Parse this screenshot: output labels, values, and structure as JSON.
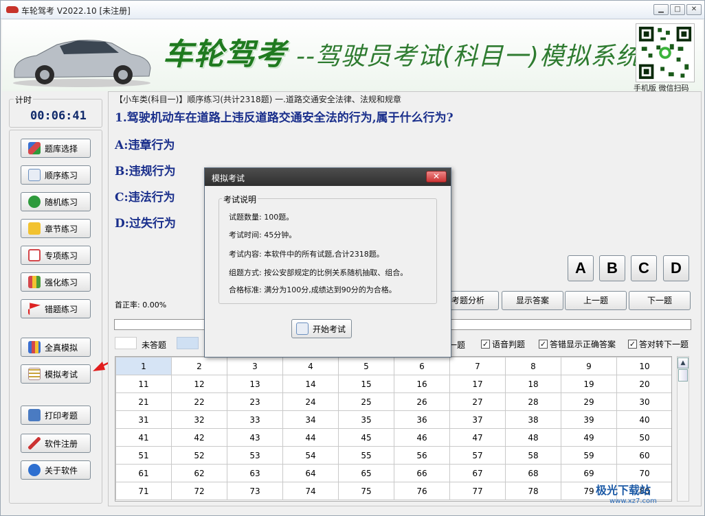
{
  "window": {
    "title": "车轮驾考 V2022.10 [未注册]",
    "min": "▁",
    "max": "□",
    "close": "✕"
  },
  "banner": {
    "brand": "车轮驾考",
    "subtitle": "--驾驶员考试(科目一)模拟系统",
    "qr_caption": "手机版 微信扫码"
  },
  "timer": {
    "label": "计时",
    "value": "00:06:41"
  },
  "sidebar": [
    {
      "label": "题库选择",
      "icon": "cubes-icon",
      "color": "#3a6fd1"
    },
    {
      "label": "顺序练习",
      "icon": "pencil-icon",
      "color": "#6a8fbf"
    },
    {
      "label": "随机练习",
      "icon": "refresh-icon",
      "color": "#2e9a3c"
    },
    {
      "label": "章节练习",
      "icon": "note-icon",
      "color": "#f2c230"
    },
    {
      "label": "专项练习",
      "icon": "checklist-icon",
      "color": "#d4474b"
    },
    {
      "label": "强化练习",
      "icon": "barchart-icon",
      "color": "#4b9c3a"
    },
    {
      "label": "错题练习",
      "icon": "flag-icon",
      "color": "#d22"
    },
    {
      "label": "全真模拟",
      "icon": "grid-icon",
      "color": "#3a6fd1"
    },
    {
      "label": "模拟考试",
      "icon": "table-icon",
      "color": "#c9a33a"
    },
    {
      "label": "打印考题",
      "icon": "printer-icon",
      "color": "#4a7bc2"
    },
    {
      "label": "软件注册",
      "icon": "pen-icon",
      "color": "#c33"
    },
    {
      "label": "关于软件",
      "icon": "info-icon",
      "color": "#2d6fd0"
    }
  ],
  "main": {
    "crumb": "【小车类(科目一)】顺序练习(共计2318题) 一.道路交通安全法律、法规和规章",
    "question": "1.驾驶机动车在道路上违反道路交通安全法的行为,属于什么行为?",
    "options": [
      "A:违章行为",
      "B:违规行为",
      "C:违法行为",
      "D:过失行为"
    ],
    "answers": [
      "A",
      "B",
      "C",
      "D"
    ],
    "accuracy": "首正率: 0.00%",
    "nav": [
      "考题分析",
      "显示答案",
      "上一题",
      "下一题"
    ],
    "legend_unanswered": "未答题",
    "hidden_label": "一题",
    "checks": [
      "语音判题",
      "答错显示正确答案",
      "答对转下一题"
    ],
    "grid": [
      [
        "1",
        "2",
        "3",
        "4",
        "5",
        "6",
        "7",
        "8",
        "9",
        "10"
      ],
      [
        "11",
        "12",
        "13",
        "14",
        "15",
        "16",
        "17",
        "18",
        "19",
        "20"
      ],
      [
        "21",
        "22",
        "23",
        "24",
        "25",
        "26",
        "27",
        "28",
        "29",
        "30"
      ],
      [
        "31",
        "32",
        "33",
        "34",
        "35",
        "36",
        "37",
        "38",
        "39",
        "40"
      ],
      [
        "41",
        "42",
        "43",
        "44",
        "45",
        "46",
        "47",
        "48",
        "49",
        "50"
      ],
      [
        "51",
        "52",
        "53",
        "54",
        "55",
        "56",
        "57",
        "58",
        "59",
        "60"
      ],
      [
        "61",
        "62",
        "63",
        "64",
        "65",
        "66",
        "67",
        "68",
        "69",
        "70"
      ],
      [
        "71",
        "72",
        "73",
        "74",
        "75",
        "76",
        "77",
        "78",
        "79",
        "80"
      ]
    ]
  },
  "dialog": {
    "title": "模拟考试",
    "close": "✕",
    "group_label": "考试说明",
    "lines": [
      "试题数量: 100题。",
      "考试时间: 45分钟。",
      "考试内容: 本软件中的所有试题,合计2318题。",
      "组题方式: 按公安部规定的比例关系随机抽取、组合。",
      "合格标准: 满分为100分,成绩达到90分的为合格。"
    ],
    "start": "开始考试"
  },
  "watermark": {
    "main": "极光下载站",
    "sub": "www.xz7.com"
  }
}
